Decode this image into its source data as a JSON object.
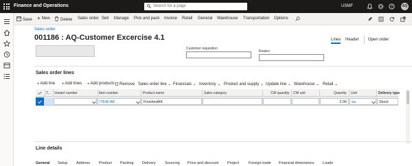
{
  "topbar": {
    "app_title": "Finance and Operations",
    "search_placeholder": "Search for a page",
    "company": "USMF"
  },
  "action_pane": {
    "items": [
      {
        "label": "Save",
        "icon": "save-icon"
      },
      {
        "label": "New",
        "icon": "plus-icon"
      },
      {
        "label": "Delete",
        "icon": "delete-icon"
      },
      {
        "label": "Sales order"
      },
      {
        "label": "Sell"
      },
      {
        "label": "Manage"
      },
      {
        "label": "Pick and pack"
      },
      {
        "label": "Invoice"
      },
      {
        "label": "Retail"
      },
      {
        "label": "General"
      },
      {
        "label": "Warehouse"
      },
      {
        "label": "Transportation"
      },
      {
        "label": "Options"
      }
    ]
  },
  "header": {
    "breadcrumb": "Sales order",
    "title": "001186 : AQ-Customer Excercise 4.1",
    "customer_requisition_label": "Customer requisition",
    "routes_label": "Routes",
    "view_tabs": [
      "Lines",
      "Header"
    ],
    "open_order": "Open order"
  },
  "lines_section": {
    "title": "Sales order lines",
    "toolbar": [
      {
        "label": "Add line",
        "icon": "plus-icon"
      },
      {
        "label": "Add lines",
        "icon": "plus-icon"
      },
      {
        "label": "Add products",
        "icon": "plus-icon"
      },
      {
        "label": "Remove",
        "icon": "delete-icon"
      },
      {
        "label": "Sales order line",
        "dropdown": true
      },
      {
        "label": "Financials",
        "dropdown": true
      },
      {
        "label": "Inventory",
        "dropdown": true
      },
      {
        "label": "Product and supply",
        "dropdown": true
      },
      {
        "label": "Update line",
        "dropdown": true
      },
      {
        "label": "Warehouse",
        "dropdown": true
      },
      {
        "label": "Retail",
        "dropdown": true
      }
    ],
    "columns": [
      "T...",
      "Variant number",
      "Item number",
      "Product name",
      "Sales category",
      "CW quantity",
      "CW unit",
      "Quantity",
      "Unit",
      "Delivery type"
    ],
    "rows": [
      {
        "variant": "",
        "item": "ITEM-AK",
        "product": "FinishedAK",
        "category": "",
        "cw_qty": "",
        "cw_unit": "",
        "quantity": "2.00",
        "unit": "ea",
        "delivery": "Stock"
      }
    ]
  },
  "line_details": {
    "title": "Line details",
    "tabs": [
      "General",
      "Setup",
      "Address",
      "Product",
      "Packing",
      "Delivery",
      "Sourcing",
      "Price and discount",
      "Project",
      "Foreign trade",
      "Financial dimensions",
      "Loads"
    ]
  },
  "colors": {
    "accent": "#0f6cbd",
    "topbar_bg": "#1b1a19",
    "selected_row": "#cfe4fa"
  }
}
